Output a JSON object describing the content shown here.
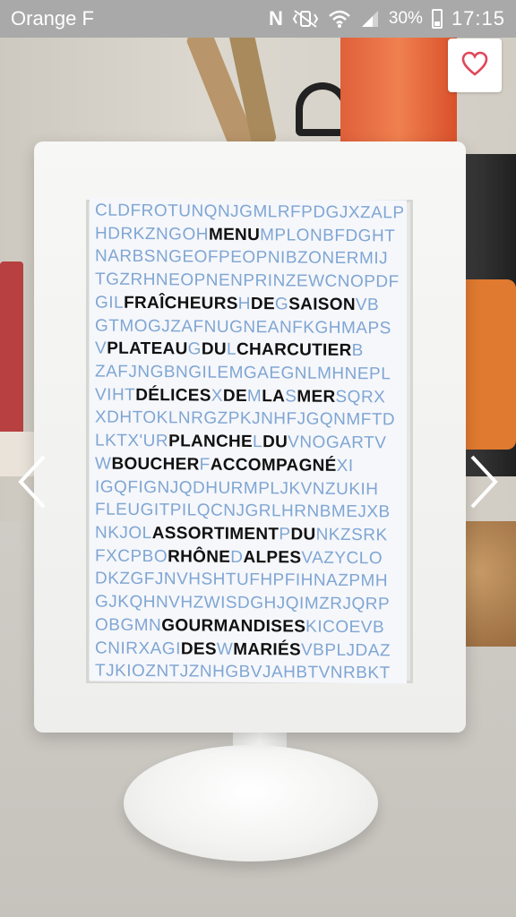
{
  "status_bar": {
    "carrier": "Orange F",
    "icons": [
      "nfc-icon",
      "vibrate-mute-icon",
      "wifi-icon",
      "signal-icon",
      "battery-charging-icon"
    ],
    "battery_percent": "30%",
    "time": "17:15"
  },
  "actions": {
    "favorite_icon": "heart-outline-icon",
    "prev_icon": "chevron-left-icon",
    "next_icon": "chevron-right-icon"
  },
  "photo": {
    "menu_card": {
      "lines": [
        {
          "segments": [
            {
              "t": "CLDFROTUNQNJGMLRFPDGJXZALP",
              "h": false
            }
          ]
        },
        {
          "segments": [
            {
              "t": "HDRKZNGOH",
              "h": false
            },
            {
              "t": "MENU",
              "h": true
            },
            {
              "t": "MPLONBFDGHT",
              "h": false
            }
          ]
        },
        {
          "segments": [
            {
              "t": "NARBSNGEOFPEOPNIBZONERMIJ",
              "h": false
            }
          ]
        },
        {
          "segments": [
            {
              "t": "TGZRHNEOPNENPRINZEWCNOPDF",
              "h": false
            }
          ]
        },
        {
          "segments": [
            {
              "t": "GIL",
              "h": false
            },
            {
              "t": "FRAÎCHEURS",
              "h": true
            },
            {
              "t": "H",
              "h": false
            },
            {
              "t": "DE",
              "h": true
            },
            {
              "t": "G",
              "h": false
            },
            {
              "t": "SAISON",
              "h": true
            },
            {
              "t": "VB",
              "h": false
            }
          ]
        },
        {
          "segments": [
            {
              "t": "GTMOGJZAFNUGNEANFKGHMAPS",
              "h": false
            }
          ]
        },
        {
          "segments": [
            {
              "t": "V",
              "h": false
            },
            {
              "t": "PLATEAU",
              "h": true
            },
            {
              "t": "G",
              "h": false
            },
            {
              "t": "DU",
              "h": true
            },
            {
              "t": "L",
              "h": false
            },
            {
              "t": "CHARCUTIER",
              "h": true
            },
            {
              "t": "B",
              "h": false
            }
          ]
        },
        {
          "segments": [
            {
              "t": "ZAFJNGBNGILEMGAEGNLMHNEPL",
              "h": false
            }
          ]
        },
        {
          "segments": [
            {
              "t": "VIHT",
              "h": false
            },
            {
              "t": "DÉLICES",
              "h": true
            },
            {
              "t": "X",
              "h": false
            },
            {
              "t": "DE",
              "h": true
            },
            {
              "t": "M",
              "h": false
            },
            {
              "t": "LA",
              "h": true
            },
            {
              "t": "S",
              "h": false
            },
            {
              "t": "MER",
              "h": true
            },
            {
              "t": "SQRX",
              "h": false
            }
          ]
        },
        {
          "segments": [
            {
              "t": "XDHTOKLNRGZPKJNHFJGQNMFTD",
              "h": false
            }
          ]
        },
        {
          "segments": [
            {
              "t": "LKTX'UR",
              "h": false
            },
            {
              "t": "PLANCHE",
              "h": true
            },
            {
              "t": "L",
              "h": false
            },
            {
              "t": "DU",
              "h": true
            },
            {
              "t": "VNOGARTV",
              "h": false
            }
          ]
        },
        {
          "segments": [
            {
              "t": "W",
              "h": false
            },
            {
              "t": "BOUCHER",
              "h": true
            },
            {
              "t": "F",
              "h": false
            },
            {
              "t": "ACCOMPAGNÉ",
              "h": true
            },
            {
              "t": "XI",
              "h": false
            }
          ]
        },
        {
          "segments": [
            {
              "t": "IGQFIGNJQDHURMPLJKVNZUKIH",
              "h": false
            }
          ]
        },
        {
          "segments": [
            {
              "t": "FLEUGITPILQCNJGRLHRNBMEJXB",
              "h": false
            }
          ]
        },
        {
          "segments": [
            {
              "t": "NKJOL",
              "h": false
            },
            {
              "t": "ASSORTIMENT",
              "h": true
            },
            {
              "t": "P",
              "h": false
            },
            {
              "t": "DU",
              "h": true
            },
            {
              "t": "NKZSRK",
              "h": false
            }
          ]
        },
        {
          "segments": [
            {
              "t": "FXCPBO",
              "h": false
            },
            {
              "t": "RHÔNE",
              "h": true
            },
            {
              "t": "D",
              "h": false
            },
            {
              "t": "ALPES",
              "h": true
            },
            {
              "t": "VAZYCLO",
              "h": false
            }
          ]
        },
        {
          "segments": [
            {
              "t": "DKZGFJNVHSHTUFHPFIHNAZPMH",
              "h": false
            }
          ]
        },
        {
          "segments": [
            {
              "t": "GJKQHNVHZWISDGHJQIMZRJQRP",
              "h": false
            }
          ]
        },
        {
          "segments": [
            {
              "t": "OBGMN",
              "h": false
            },
            {
              "t": "GOURMANDISES",
              "h": true
            },
            {
              "t": "KICOEVB",
              "h": false
            }
          ]
        },
        {
          "segments": [
            {
              "t": "CNIRXAGI",
              "h": false
            },
            {
              "t": "DES",
              "h": true
            },
            {
              "t": "W",
              "h": false
            },
            {
              "t": "MARIÉS",
              "h": true
            },
            {
              "t": "VBPLJDAZ",
              "h": false
            }
          ]
        },
        {
          "segments": [
            {
              "t": "TJKIOZNTJZNHGBVJAHBTVNRBKT",
              "h": false
            }
          ]
        }
      ]
    }
  },
  "colors": {
    "status_bar_bg": "#a9a9a9",
    "filler_letters": "#7fa6d3",
    "menu_words": "#111111",
    "heart": "#e0475a"
  }
}
